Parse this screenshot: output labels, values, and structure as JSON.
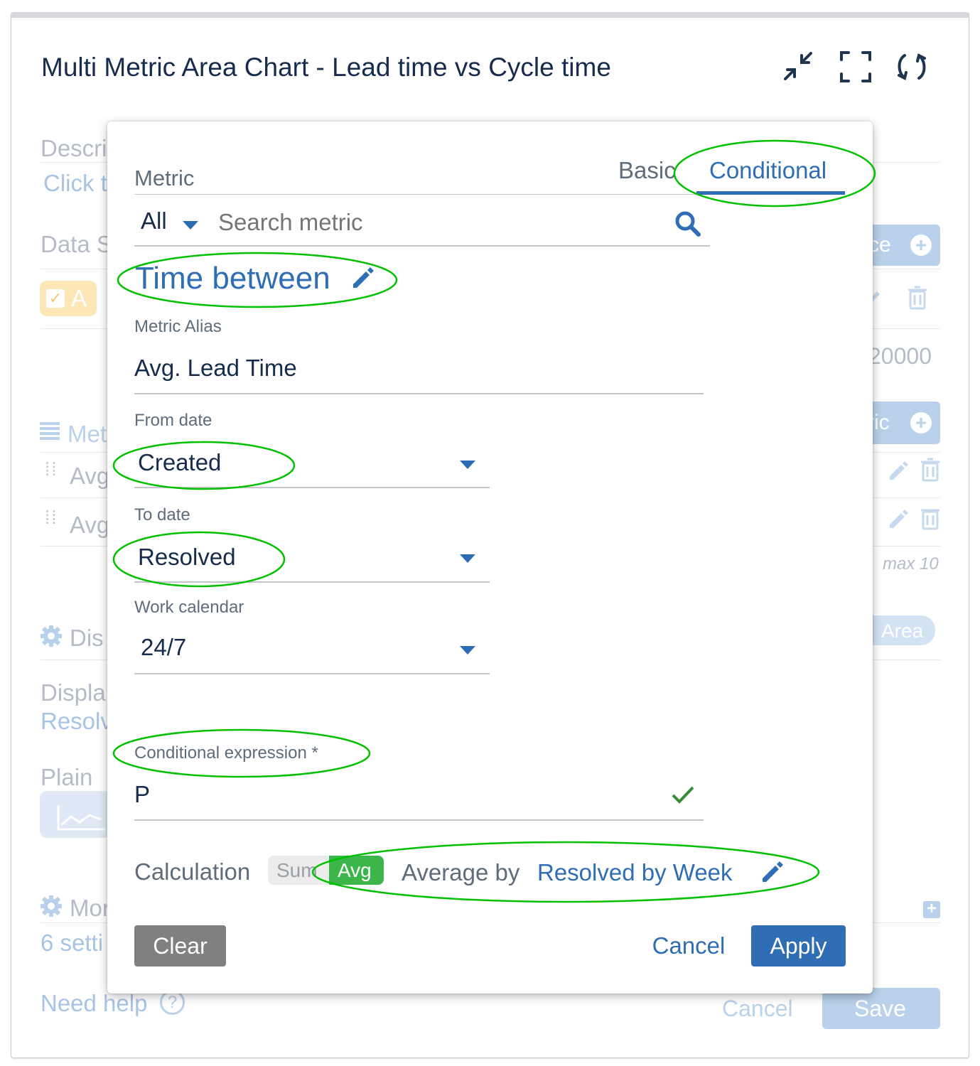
{
  "header": {
    "title": "Multi Metric Area Chart - Lead time vs Cycle time",
    "icons": [
      "collapse-icon",
      "fullscreen-icon",
      "refresh-icon"
    ]
  },
  "background_form": {
    "description_label": "Descri",
    "description_link": "Click t",
    "data_source_label": "Data S",
    "data_source_button": "ce",
    "source_chip": "A",
    "limit_value": "20000",
    "metrics_label": "Met",
    "metric_rows": [
      "Avg",
      "Avg"
    ],
    "add_metric_button": "ric",
    "max_note": "max 10",
    "display_label": "Dis",
    "display_value": "Area",
    "display_by_label": "Displa",
    "display_by_value": "Resolv",
    "plain_label": "Plain",
    "more_label": "Mor",
    "more_value": "6 setti",
    "help_link": "Need help",
    "cancel": "Cancel",
    "save": "Save"
  },
  "modal": {
    "metric_label": "Metric",
    "tabs": {
      "basic": "Basic",
      "conditional": "Conditional",
      "active": "conditional"
    },
    "filter": {
      "selected": "All",
      "search_placeholder": "Search metric"
    },
    "metric_name": "Time between",
    "alias": {
      "label": "Metric Alias",
      "value": "Avg. Lead Time"
    },
    "from_date": {
      "label": "From date",
      "value": "Created"
    },
    "to_date": {
      "label": "To date",
      "value": "Resolved"
    },
    "work_calendar": {
      "label": "Work calendar",
      "value": "24/7"
    },
    "conditional_expression": {
      "label": "Conditional expression *",
      "value": "P"
    },
    "calculation": {
      "label": "Calculation",
      "options": [
        "Sum",
        "Avg"
      ],
      "selected": "Avg",
      "average_by_label": "Average by",
      "average_by_value": "Resolved by Week"
    },
    "buttons": {
      "clear": "Clear",
      "cancel": "Cancel",
      "apply": "Apply"
    }
  },
  "colors": {
    "accent": "#2f6db4",
    "highlight_ellipse": "#00c000",
    "avg_pill": "#3cb54a",
    "clear_button": "#808080"
  }
}
